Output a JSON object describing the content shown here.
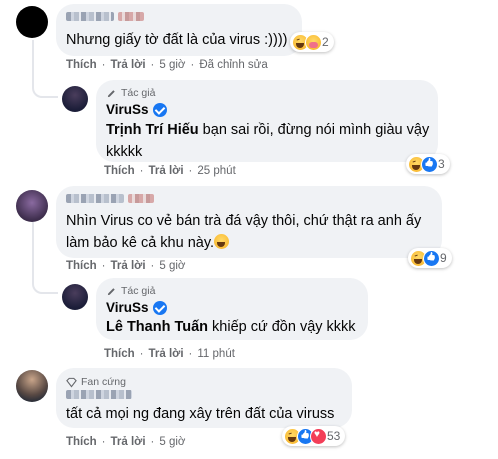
{
  "comments": [
    {
      "id": "c1",
      "text": "Nhưng giấy tờ đất là của virus :))))",
      "reactions": {
        "types": [
          "haha",
          "care"
        ],
        "count": "2"
      },
      "actions": {
        "like": "Thích",
        "reply": "Trả lời",
        "time": "5 giờ",
        "edited": "Đã chỉnh sửa"
      }
    },
    {
      "id": "r1",
      "tag": "Tác giả",
      "author": "ViruSs",
      "mention": "Trịnh Trí Hiếu",
      "text": " bạn sai rồi, đừng nói mình giàu vậy kkkkk",
      "reactions": {
        "types": [
          "haha",
          "like"
        ],
        "count": "3"
      },
      "actions": {
        "like": "Thích",
        "reply": "Trả lời",
        "time": "25 phút"
      }
    },
    {
      "id": "c2",
      "text": "Nhìn Virus co vẻ bán trà đá vậy thôi, chứ thật ra anh ấy làm bảo kê cả khu này.",
      "reactions": {
        "types": [
          "haha",
          "like"
        ],
        "count": "9"
      },
      "actions": {
        "like": "Thích",
        "reply": "Trả lời",
        "time": "5 giờ"
      }
    },
    {
      "id": "r2",
      "tag": "Tác giả",
      "author": "ViruSs",
      "mention": "Lê Thanh Tuấn",
      "text": " khiếp cứ đồn vậy kkkk",
      "actions": {
        "like": "Thích",
        "reply": "Trả lời",
        "time": "11 phút"
      }
    },
    {
      "id": "c3",
      "tag": "Fan cứng",
      "text": "tất cả mọi ng đang xây trên đất của viruss",
      "reactions": {
        "types": [
          "haha",
          "like",
          "love"
        ],
        "count": "53"
      },
      "actions": {
        "like": "Thích",
        "reply": "Trả lời",
        "time": "5 giờ"
      }
    }
  ],
  "colors": {
    "bubble": "#f0f2f5",
    "secondary_text": "#65676b",
    "verified": "#1877f2"
  }
}
